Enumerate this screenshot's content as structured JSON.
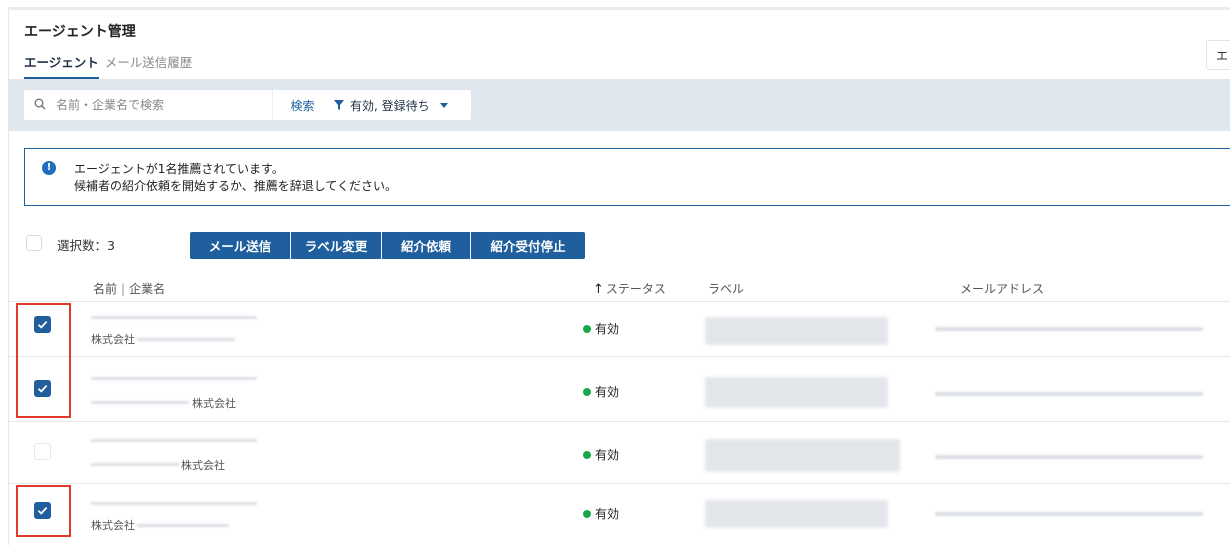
{
  "header": {
    "title": "エージェント管理",
    "tabs": [
      {
        "label": "エージェント",
        "active": true
      },
      {
        "label": "メール送信履歴",
        "active": false
      }
    ],
    "corner_stub_text": "エ"
  },
  "filter": {
    "search_placeholder": "名前・企業名で検索",
    "search_button": "検索",
    "status_filter_value": "有効, 登録待ち"
  },
  "alert": {
    "line1": "エージェントが1名推薦されています。",
    "line2": "候補者の紹介依頼を開始するか、推薦を辞退してください。"
  },
  "selection": {
    "count_label": "選択数：3"
  },
  "actions": [
    {
      "label": "メール送信"
    },
    {
      "label": "ラベル変更"
    },
    {
      "label": "紹介依頼"
    },
    {
      "label": "紹介受付停止"
    }
  ],
  "table": {
    "columns": {
      "name": "名前",
      "separator": "|",
      "company": "企業名",
      "status_arrow": "↑",
      "status": "ステータス",
      "label": "ラベル",
      "email": "メールアドレス"
    },
    "rows": [
      {
        "checked": true,
        "company_suffix": "株式会社",
        "status": "有効"
      },
      {
        "checked": true,
        "company_suffix": "株式会社",
        "status": "有効"
      },
      {
        "checked": false,
        "company_suffix": "株式会社",
        "status": "有効"
      },
      {
        "checked": true,
        "company_suffix": "株式会社",
        "status": "有効"
      }
    ]
  },
  "colors": {
    "primary": "#1f5f9e",
    "status_active": "#18a84a",
    "highlight": "#e03a2f",
    "filter_bar": "#dfe6ee"
  }
}
